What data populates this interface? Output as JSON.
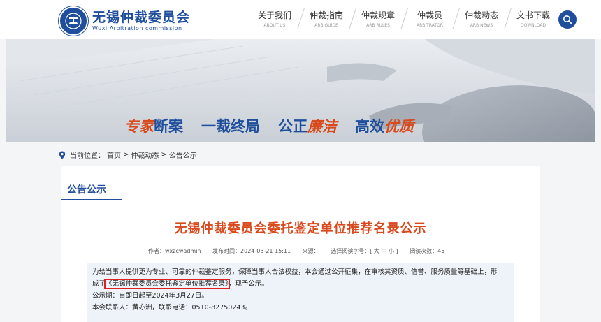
{
  "site": {
    "name_cn": "无锡仲裁委员会",
    "name_en": "Wuxi Arbitration commission"
  },
  "nav": [
    {
      "cn": "关于我们",
      "en": "ABOUT US"
    },
    {
      "cn": "仲裁指南",
      "en": "ARB GUIDE"
    },
    {
      "cn": "仲裁规章",
      "en": "ARB RULES"
    },
    {
      "cn": "仲裁员",
      "en": "ARBITRATOR"
    },
    {
      "cn": "仲裁动态",
      "en": "ARB NEWS"
    },
    {
      "cn": "文书下载",
      "en": "DOWNLOAD"
    }
  ],
  "banner": {
    "slogan": [
      {
        "a": "专家",
        "b": "断案"
      },
      {
        "a": "一裁终局",
        "b": ""
      },
      {
        "a": "公正",
        "b": "廉洁"
      },
      {
        "a": "高效",
        "b": "优质"
      }
    ]
  },
  "breadcrumb": {
    "prefix": "当前位置：",
    "items": [
      "首页",
      "仲裁动态",
      "公告公示"
    ],
    "sep": ">"
  },
  "section": {
    "title": "公告公示"
  },
  "article": {
    "title": "无锡仲裁委员会委托鉴定单位推荐名录公示",
    "author": "作者：wxzcwadmin",
    "time": "发布时间：2024-03-21 15:11",
    "source": "来源：",
    "font": "选择阅读字号：[ 大 中 小 ]",
    "views": "阅读次数：45",
    "para1": "为给当事人提供更为专业、可靠的仲裁鉴定服务，保障当事人合法权益，本会通过公开征集，在审核其资质、信誉、服务质量等基础上，形",
    "para2_prefix": "成了",
    "para2_link": "《无锡仲裁委员会委托鉴定单位推荐名录》",
    "para2_suffix": "，现予公示。",
    "para3": "公示期：自即日起至2024年3月27日。",
    "para4": "本会联系人：黄亦洲，联系电话：0510-82750243。"
  }
}
